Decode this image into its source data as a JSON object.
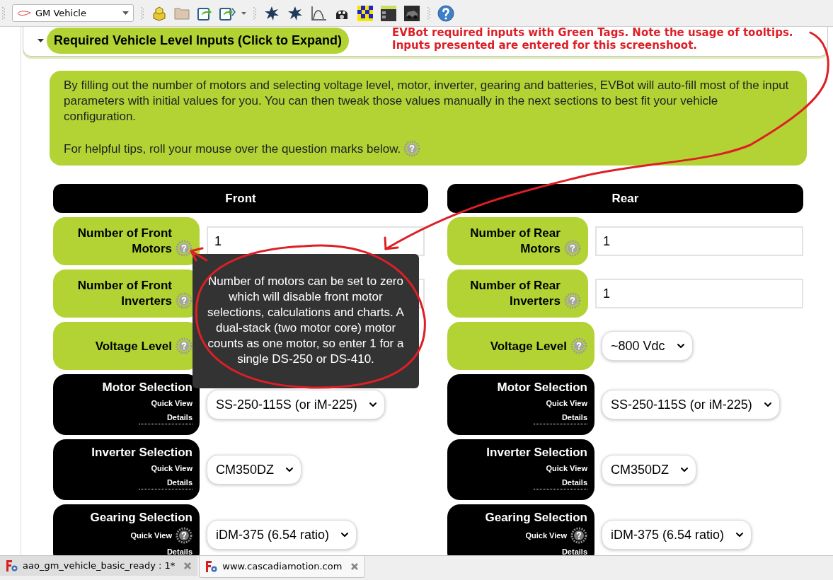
{
  "toolbar": {
    "document_selector": "GM Vehicle"
  },
  "panel": {
    "title": "Required Vehicle Level Inputs (Click to Expand)",
    "expanded": true,
    "annotation": [
      "EVBot required inputs with Green Tags. Note the usage of tooltips.",
      "Inputs presented are entered for this screenshoot."
    ]
  },
  "intro": {
    "paragraphs": [
      {
        "text": "By filling out the number of motors and selecting voltage level, motor, inverter, gearing and batteries, EVBot will auto-fill most of the input parameters with initial values for you. You can then tweak those values manually in the next sections to best fit your vehicle configuration.",
        "help_icon": false
      },
      {
        "text": "For helpful tips, roll your mouse over the question marks below.",
        "help_icon": true
      }
    ]
  },
  "columns": [
    {
      "title": "Front",
      "rows": [
        {
          "kind": "text",
          "label": "Number of Front Motors",
          "color": "#b3d335",
          "help_icon": true,
          "value": "1"
        },
        {
          "kind": "text",
          "label": "Number of Front Inverters",
          "color": "#b3d335",
          "help_icon": true
        },
        {
          "kind": "select",
          "label": "Voltage Level",
          "color": "#b3d335",
          "help_icon": true
        },
        {
          "kind": "select",
          "label": "Motor Selection",
          "color": "#000000",
          "help_icon": false,
          "links": [
            "Quick View",
            "Details"
          ],
          "value": "SS-250-115S (or iM-225)"
        },
        {
          "kind": "select",
          "label": "Inverter Selection",
          "color": "#000000",
          "help_icon": false,
          "links": [
            "Quick View",
            "Details"
          ],
          "value": "CM350DZ"
        },
        {
          "kind": "select",
          "label": "Gearing Selection",
          "color": "#000000",
          "help_icon": true,
          "links": [
            "Quick View",
            "Details"
          ],
          "value": "iDM-375 (6.54 ratio)"
        }
      ]
    },
    {
      "title": "Rear",
      "rows": [
        {
          "kind": "text",
          "label": "Number of Rear Motors",
          "color": "#b3d335",
          "help_icon": true,
          "value": "1"
        },
        {
          "kind": "text",
          "label": "Number of Rear Inverters",
          "color": "#b3d335",
          "help_icon": true,
          "value": "1"
        },
        {
          "kind": "select",
          "label": "Voltage Level",
          "color": "#b3d335",
          "help_icon": true,
          "value": "~800 Vdc"
        },
        {
          "kind": "select",
          "label": "Motor Selection",
          "color": "#000000",
          "help_icon": false,
          "links": [
            "Quick View",
            "Details"
          ],
          "value": "SS-250-115S (or iM-225)"
        },
        {
          "kind": "select",
          "label": "Inverter Selection",
          "color": "#000000",
          "help_icon": false,
          "links": [
            "Quick View",
            "Details"
          ],
          "value": "CM350DZ"
        },
        {
          "kind": "select",
          "label": "Gearing Selection",
          "color": "#000000",
          "help_icon": true,
          "links": [
            "Quick View",
            "Details"
          ],
          "value": "iDM-375 (6.54 ratio)"
        }
      ]
    }
  ],
  "tooltip": {
    "text": "Number of motors can be set to zero which will disable front motor selections, calculations and charts. A dual-stack (two motor core) motor counts as one motor, so enter 1 for a single DS-250 or DS-410."
  },
  "document_tabs": [
    {
      "label": "aao_gm_vehicle_basic_ready : 1*",
      "selected": false
    },
    {
      "label": "www.cascadiamotion.com",
      "selected": true
    }
  ]
}
